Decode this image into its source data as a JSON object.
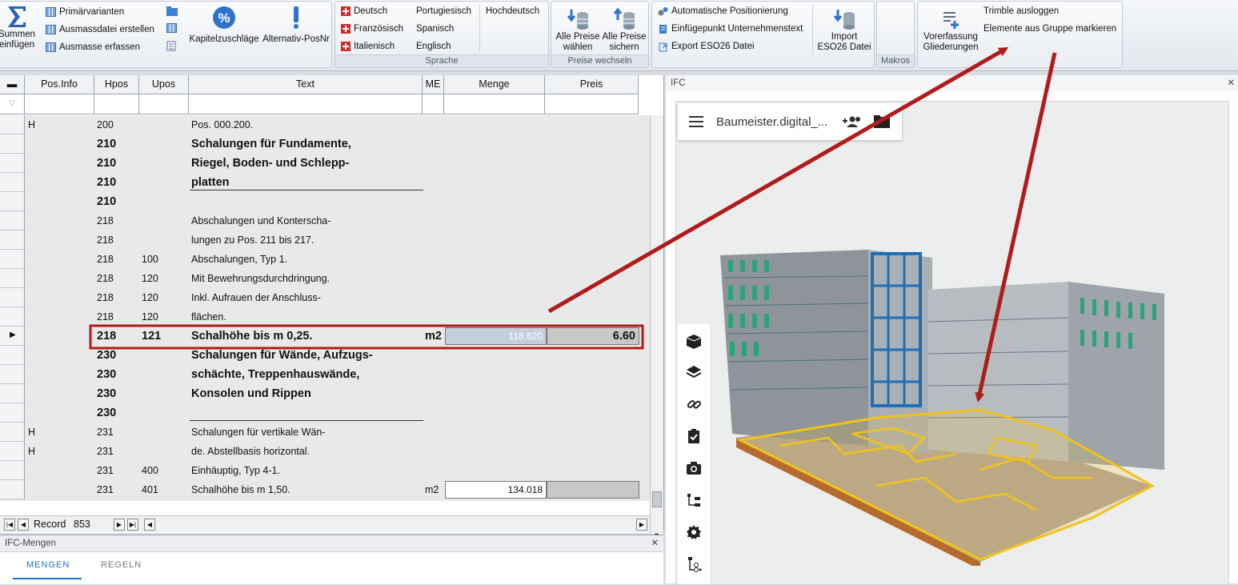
{
  "ribbon": {
    "g1": {
      "summen": "Summen\neinfügen",
      "prim": "Primärvarianten",
      "ausmassdatei": "Ausmassdatei erstellen",
      "ausmasse": "Ausmasse erfassen",
      "kapitel": "Kapitelzuschläge",
      "alternativ": "Alternativ-PosNr"
    },
    "sprache": {
      "label": "Sprache",
      "deutsch": "Deutsch",
      "franz": "Französisch",
      "ital": "Italienisch",
      "port": "Portugiesisch",
      "span": "Spanisch",
      "engl": "Englisch",
      "hoch": "Hochdeutsch"
    },
    "preise": {
      "label": "Preise wechseln",
      "waehlen": "Alle Preise\nwählen",
      "sichern": "Alle Preise\nsichern"
    },
    "ifc": {
      "auto": "Automatische Positionierung",
      "einfueg": "Einfügepunkt Unternehmenstext",
      "export": "Export ESO26 Datei",
      "import": "Import\nESO26 Datei"
    },
    "makros": {
      "label": "Makros"
    },
    "trimble": {
      "vorfassung": "Vorerfassung\nGliederungen",
      "logout": "Trimble ausloggen",
      "markieren": "Elemente aus Gruppe markieren"
    }
  },
  "grid": {
    "headers": [
      "Pos.Info",
      "Hpos",
      "Upos",
      "Text",
      "ME",
      "Menge",
      "Preis"
    ],
    "rows": [
      {
        "info": "H",
        "hpos": "200",
        "upos": "",
        "text": "Pos. 000.200.",
        "me": "",
        "bold": false
      },
      {
        "info": "",
        "hpos": "210",
        "upos": "",
        "text": "Schalungen für Fundamente,",
        "me": "",
        "bold": true
      },
      {
        "info": "",
        "hpos": "210",
        "upos": "",
        "text": "Riegel, Boden- und Schlepp-",
        "me": "",
        "bold": true
      },
      {
        "info": "",
        "hpos": "210",
        "upos": "",
        "text": "platten",
        "me": "",
        "bold": true
      },
      {
        "info": "",
        "hpos": "210",
        "upos": "",
        "text": "",
        "me": "",
        "bold": true
      },
      {
        "info": "",
        "hpos": "218",
        "upos": "",
        "text": "Abschalungen und Konterscha-",
        "me": "",
        "bold": false
      },
      {
        "info": "",
        "hpos": "218",
        "upos": "",
        "text": "lungen zu Pos. 211 bis 217.",
        "me": "",
        "bold": false
      },
      {
        "info": "",
        "hpos": "218",
        "upos": "100",
        "text": "Abschalungen, Typ 1.",
        "me": "",
        "bold": false
      },
      {
        "info": "",
        "hpos": "218",
        "upos": "120",
        "text": "Mit Bewehrungsdurchdringung.",
        "me": "",
        "bold": false
      },
      {
        "info": "",
        "hpos": "218",
        "upos": "120",
        "text": "Inkl. Aufrauen der Anschluss-",
        "me": "",
        "bold": false
      },
      {
        "info": "",
        "hpos": "218",
        "upos": "120",
        "text": "flächen.",
        "me": "",
        "bold": false
      },
      {
        "info": "",
        "hpos": "218",
        "upos": "121",
        "text": "Schalhöhe bis m 0,25.",
        "me": "m2",
        "bold": true,
        "menge": "118.620",
        "preis": "6.60",
        "selected": true
      },
      {
        "info": "",
        "hpos": "230",
        "upos": "",
        "text": "Schalungen für Wände, Aufzugs-",
        "me": "",
        "bold": true
      },
      {
        "info": "",
        "hpos": "230",
        "upos": "",
        "text": "schächte, Treppenhauswände,",
        "me": "",
        "bold": true
      },
      {
        "info": "",
        "hpos": "230",
        "upos": "",
        "text": "Konsolen und Rippen",
        "me": "",
        "bold": true
      },
      {
        "info": "",
        "hpos": "230",
        "upos": "",
        "text": "",
        "me": "",
        "bold": true
      },
      {
        "info": "H",
        "hpos": "231",
        "upos": "",
        "text": "Schalungen für vertikale Wän-",
        "me": "",
        "bold": false
      },
      {
        "info": "H",
        "hpos": "231",
        "upos": "",
        "text": "de. Abstellbasis horizontal.",
        "me": "",
        "bold": false
      },
      {
        "info": "",
        "hpos": "231",
        "upos": "400",
        "text": "Einhäuptig, Typ 4-1.",
        "me": "",
        "bold": false
      },
      {
        "info": "",
        "hpos": "231",
        "upos": "401",
        "text": "Schalhöhe bis m 1,50.",
        "me": "m2",
        "bold": false,
        "menge": "134.018",
        "preis": ""
      }
    ],
    "record_label": "Record",
    "record_value": "853"
  },
  "bottom": {
    "title": "IFC-Mengen",
    "tab1": "MENGEN",
    "tab2": "REGELN"
  },
  "right": {
    "title": "IFC",
    "viewer_title": "Baumeister.digital_..."
  },
  "colors": {
    "highlight_red": "#b01b1b",
    "ifc_yellow": "#f2c21b",
    "glass_green": "#2aa37a",
    "steel_blue": "#1f6fb8"
  }
}
